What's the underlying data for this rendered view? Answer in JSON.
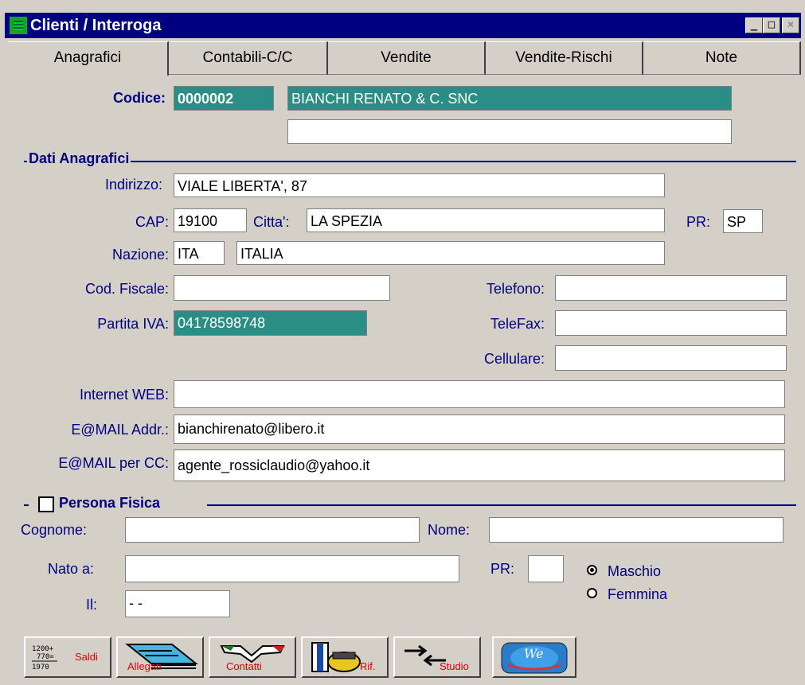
{
  "window": {
    "title": "Clienti / Interroga",
    "min_glyph": "_",
    "max_glyph": "□",
    "close_glyph": "×"
  },
  "tabs": [
    {
      "label": "Anagrafici",
      "active": true
    },
    {
      "label": "Contabili-C/C"
    },
    {
      "label": "Vendite"
    },
    {
      "label": "Vendite-Rischi"
    },
    {
      "label": "Note"
    }
  ],
  "codice": {
    "label": "Codice:",
    "value": "0000002",
    "name": "BIANCHI RENATO & C. SNC",
    "name2": ""
  },
  "dati_anagrafici": {
    "title": "Dati Anagrafici",
    "indirizzo_label": "Indirizzo:",
    "indirizzo": "VIALE LIBERTA', 87",
    "cap_label": "CAP:",
    "cap": "19100",
    "citta_label": "Citta':",
    "citta": "LA SPEZIA",
    "pr_label": "PR:",
    "pr": "SP",
    "nazione_label": "Nazione:",
    "nazione_code": "ITA",
    "nazione_name": "ITALIA",
    "cod_fiscale_label": "Cod. Fiscale:",
    "cod_fiscale": "",
    "partita_iva_label": "Partita IVA:",
    "partita_iva": "04178598748",
    "telefono_label": "Telefono:",
    "telefono": "",
    "telefax_label": "TeleFax:",
    "telefax": "",
    "cellulare_label": "Cellulare:",
    "cellulare": "",
    "web_label": "Internet WEB:",
    "web": "",
    "email_label": "E@MAIL Addr.:",
    "email": "bianchirenato@libero.it",
    "email_cc_label": "E@MAIL per CC:",
    "email_cc": "agente_rossiclaudio@yahoo.it"
  },
  "persona_fisica": {
    "title": "Persona Fisica",
    "checked": false,
    "cognome_label": "Cognome:",
    "cognome": "",
    "nome_label": "Nome:",
    "nome": "",
    "nato_label": "Nato a:",
    "nato": "",
    "pr_label": "PR:",
    "pr": "",
    "il_label": "Il:",
    "il": " -  -",
    "sesso_options": [
      "Maschio",
      "Femmina"
    ],
    "sesso_selected": "Maschio"
  },
  "toolbar": {
    "saldi_numbers": "1200+\n770=\n1970",
    "saldi_label": "Saldi",
    "allegati_label": "Allegati",
    "contatti_label": "Contatti",
    "rif_label": "Rif.",
    "studio_label": "Studio",
    "web_label": "We"
  },
  "colors": {
    "teal_field": "#2a8d86",
    "section_blue": "#000080",
    "caption_red": "#d00000"
  }
}
